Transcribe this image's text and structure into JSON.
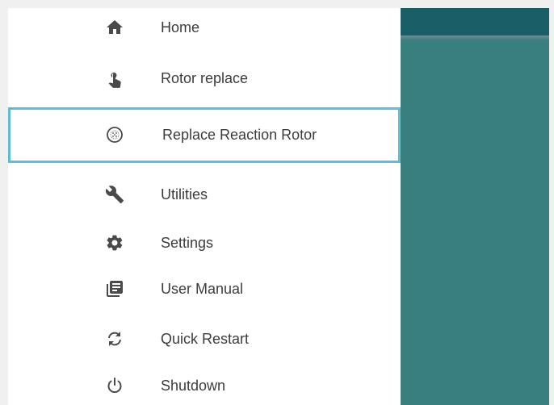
{
  "drawer": {
    "items": [
      {
        "label": "Home",
        "icon": "home-icon",
        "selected": false
      },
      {
        "label": "Rotor replace",
        "icon": "touch-icon",
        "selected": false
      },
      {
        "label": "Replace Reaction Rotor",
        "icon": "rotor-icon",
        "selected": true
      },
      {
        "label": "Utilities",
        "icon": "wrench-icon",
        "selected": false
      },
      {
        "label": "Settings",
        "icon": "gear-icon",
        "selected": false
      },
      {
        "label": "User Manual",
        "icon": "manual-icon",
        "selected": false
      },
      {
        "label": "Quick Restart",
        "icon": "restart-icon",
        "selected": false
      },
      {
        "label": "Shutdown",
        "icon": "power-icon",
        "selected": false
      }
    ]
  },
  "colors": {
    "drawer_background": "#ffffff",
    "content_background": "#3a7f80",
    "app_bar": "#1a5e67",
    "selection_outline": "#5bbdd6",
    "text": "#3c3c3c",
    "icon": "#4a4a4a"
  }
}
